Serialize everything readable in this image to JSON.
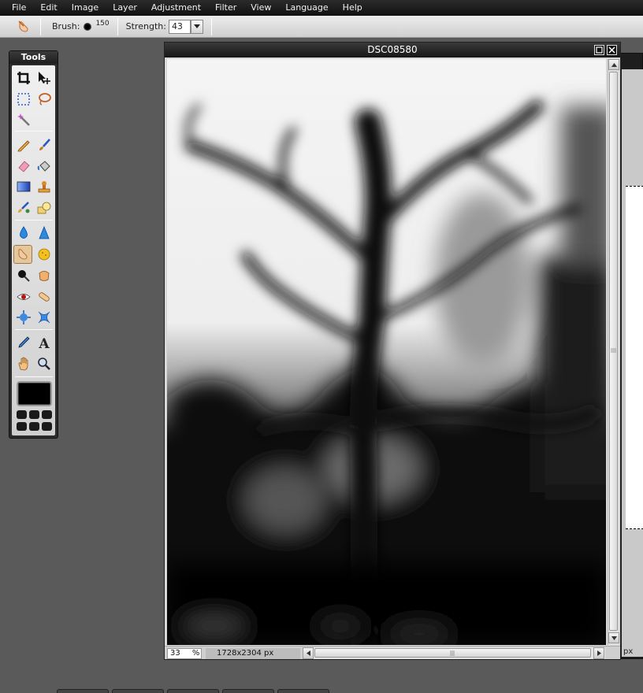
{
  "menu": {
    "items": [
      "File",
      "Edit",
      "Image",
      "Layer",
      "Adjustment",
      "Filter",
      "View",
      "Language",
      "Help"
    ]
  },
  "options": {
    "active_tool_icon": "finger-smudge-icon",
    "brush_label": "Brush:",
    "brush_size": "150",
    "strength_label": "Strength:",
    "strength_value": "43"
  },
  "tools_panel": {
    "title": "Tools",
    "tools": [
      "crop-icon",
      "move-icon",
      "marquee-select-icon",
      "lasso-icon",
      "magic-wand-icon",
      "pencil-icon",
      "brush-icon",
      "eraser-icon",
      "paint-bucket-icon",
      "gradient-icon",
      "clone-stamp-icon",
      "color-replace-icon",
      "draw-shape-icon",
      "blur-icon",
      "sharpen-icon",
      "smudge-icon",
      "sponge-icon",
      "dodge-icon",
      "burn-icon",
      "red-eye-icon",
      "spot-heal-icon",
      "bloat-icon",
      "pinch-icon",
      "color-picker-icon",
      "type-icon",
      "hand-icon",
      "zoom-icon"
    ],
    "active_tool": "smudge-icon",
    "foreground_color": "#000000"
  },
  "image_window": {
    "title": "DSC08580",
    "zoom_value": "33",
    "zoom_unit": "%",
    "dimensions": "1728x2304 px"
  },
  "background_window": {
    "unit_label": "px"
  }
}
